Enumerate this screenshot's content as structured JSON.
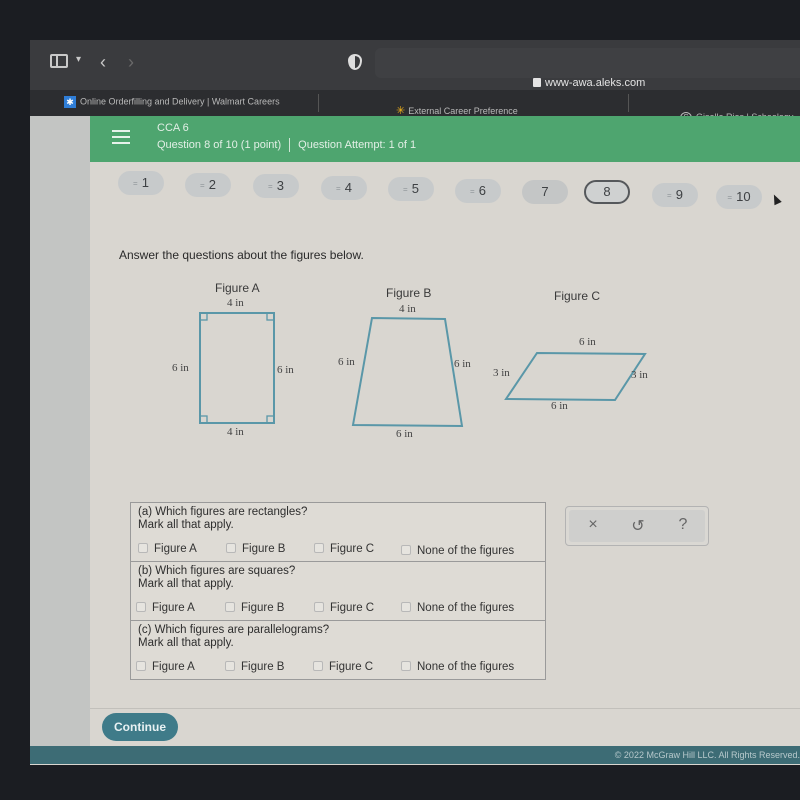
{
  "browser": {
    "url": "www-awa.aleks.com",
    "tabs": [
      {
        "label": "Online Orderfilling and Delivery | Walmart Careers",
        "icon": "walmart-spark-icon"
      },
      {
        "label": "External Career Preference",
        "icon": "walmart-spark-icon"
      },
      {
        "label": "Giselle Rios | Schoology",
        "icon": "schoology-icon"
      }
    ]
  },
  "header": {
    "course": "CCA 6",
    "question_info": "Question 8 of 10 (1 point)",
    "attempt_info": "Question Attempt: 1 of 1",
    "accent_color": "#4ea56f"
  },
  "question_nav": {
    "items": [
      {
        "label": "1",
        "answered": true
      },
      {
        "label": "2",
        "answered": true
      },
      {
        "label": "3",
        "answered": true
      },
      {
        "label": "4",
        "answered": true
      },
      {
        "label": "5",
        "answered": true
      },
      {
        "label": "6",
        "answered": true
      },
      {
        "label": "7",
        "answered": false
      },
      {
        "label": "8",
        "answered": false,
        "current": true
      },
      {
        "label": "9",
        "answered": true
      },
      {
        "label": "10",
        "answered": true
      }
    ],
    "answered_icon": "="
  },
  "problem": {
    "instruction": "Answer the questions about the figures below.",
    "figures": [
      {
        "title": "Figure A",
        "top": "4 in",
        "bottom": "4 in",
        "left": "6 in",
        "right": "6 in",
        "shape": "rectangle"
      },
      {
        "title": "Figure B",
        "top": "4 in",
        "bottom": "6 in",
        "left": "6 in",
        "right": "6 in",
        "shape": "trapezoid"
      },
      {
        "title": "Figure C",
        "top": "6 in",
        "bottom": "6 in",
        "left": "3 in",
        "right": "3 in",
        "shape": "parallelogram"
      }
    ],
    "parts": [
      {
        "question": "(a) Which figures are rectangles?",
        "hint": "Mark all that apply.",
        "options": [
          "Figure A",
          "Figure B",
          "Figure C",
          "None of the figures"
        ]
      },
      {
        "question": "(b) Which figures are squares?",
        "hint": "Mark all that apply.",
        "options": [
          "Figure A",
          "Figure B",
          "Figure C",
          "None of the figures"
        ]
      },
      {
        "question": "(c) Which figures are parallelograms?",
        "hint": "Mark all that apply.",
        "options": [
          "Figure A",
          "Figure B",
          "Figure C",
          "None of the figures"
        ]
      }
    ]
  },
  "tools": {
    "clear": "×",
    "undo": "↺",
    "help": "?"
  },
  "footer": {
    "continue_label": "Continue",
    "copyright": "© 2022 McGraw Hill LLC. All Rights Reserved."
  }
}
